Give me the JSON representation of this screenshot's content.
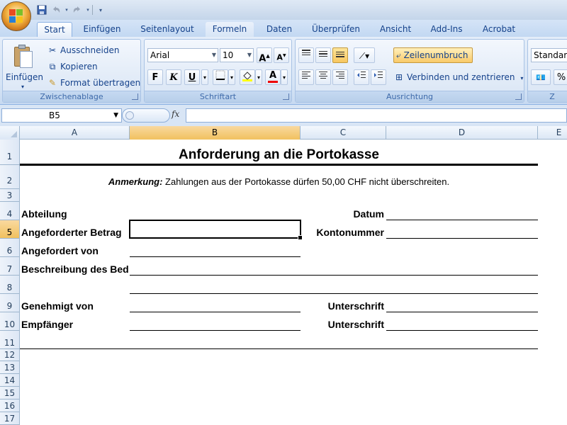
{
  "app": {
    "quick_access": [
      "save-icon",
      "undo-icon",
      "redo-icon",
      "customize-icon"
    ]
  },
  "tabs": [
    "Start",
    "Einfügen",
    "Seitenlayout",
    "Formeln",
    "Daten",
    "Überprüfen",
    "Ansicht",
    "Add-Ins",
    "Acrobat"
  ],
  "ribbon": {
    "clipboard": {
      "paste_label": "Einfügen",
      "cut_label": "Ausschneiden",
      "copy_label": "Kopieren",
      "format_painter_label": "Format übertragen",
      "group_label": "Zwischenablage"
    },
    "font": {
      "font_name": "Arial",
      "font_size": "10",
      "bold": "F",
      "italic": "K",
      "underline": "U",
      "group_label": "Schriftart"
    },
    "alignment": {
      "wrap_label": "Zeilenumbruch",
      "merge_label": "Verbinden und zentrieren",
      "group_label": "Ausrichtung"
    },
    "number": {
      "format_value": "Standard",
      "percent": "%",
      "group_label_partial": "Z"
    }
  },
  "formula_bar": {
    "name_box": "B5",
    "fx": "fx",
    "value": ""
  },
  "grid": {
    "columns": [
      "A",
      "B",
      "C",
      "D",
      "E"
    ],
    "selected_column": "B",
    "rows": [
      "1",
      "2",
      "3",
      "4",
      "5",
      "6",
      "7",
      "8",
      "9",
      "10",
      "11",
      "12",
      "13",
      "14",
      "15",
      "16",
      "17"
    ],
    "selected_row": "5"
  },
  "sheet": {
    "title": "Anforderung an die Portokasse",
    "note_label": "Anmerkung:",
    "note_text": " Zahlungen aus der Portokasse dürfen 50,00 CHF nicht überschreiten.",
    "labels": {
      "department": "Abteilung",
      "date": "Datum",
      "amount": "Angeforderter Betrag",
      "account": "Kontonummer",
      "requested_by": "Angefordert von",
      "description": "Beschreibung des Bed",
      "approved_by": "Genehmigt von",
      "signature1": "Unterschrift",
      "recipient": "Empfänger",
      "signature2": "Unterschrift"
    }
  },
  "colors": {
    "ribbon_text": "#15428b",
    "selection_header": "#f1c15f",
    "active_button": "#f9ca6a"
  }
}
